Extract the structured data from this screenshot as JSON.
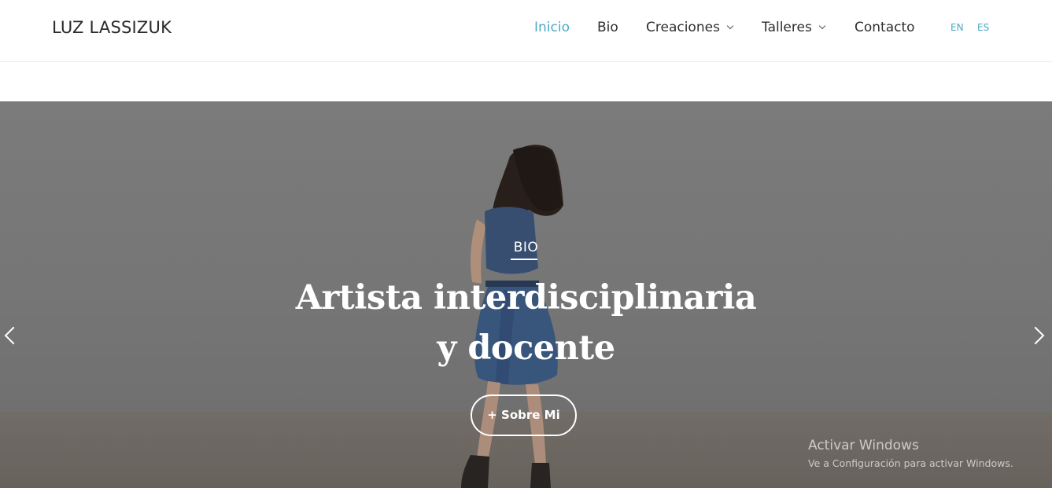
{
  "header": {
    "logo": "LUZ LASSIZUK",
    "nav": [
      {
        "label": "Inicio",
        "active": true,
        "dropdown": false
      },
      {
        "label": "Bio",
        "active": false,
        "dropdown": false
      },
      {
        "label": "Creaciones",
        "active": false,
        "dropdown": true
      },
      {
        "label": "Talleres",
        "active": false,
        "dropdown": true
      },
      {
        "label": "Contacto",
        "active": false,
        "dropdown": false
      }
    ],
    "languages": [
      "EN",
      "ES"
    ]
  },
  "hero": {
    "kicker": "BIO",
    "headline_line1": "Artista interdisciplinaria",
    "headline_line2": "y docente",
    "cta_label": "+ Sobre Mi"
  },
  "watermark": {
    "title": "Activar Windows",
    "subtitle": "Ve a Configuración para activar Windows."
  },
  "colors": {
    "accent": "#4fa9c2",
    "text": "#2e2e2e",
    "dress": "#3a5377"
  },
  "icons": {
    "prev": "chevron-left-icon",
    "next": "chevron-right-icon",
    "dropdown": "chevron-down-icon"
  }
}
